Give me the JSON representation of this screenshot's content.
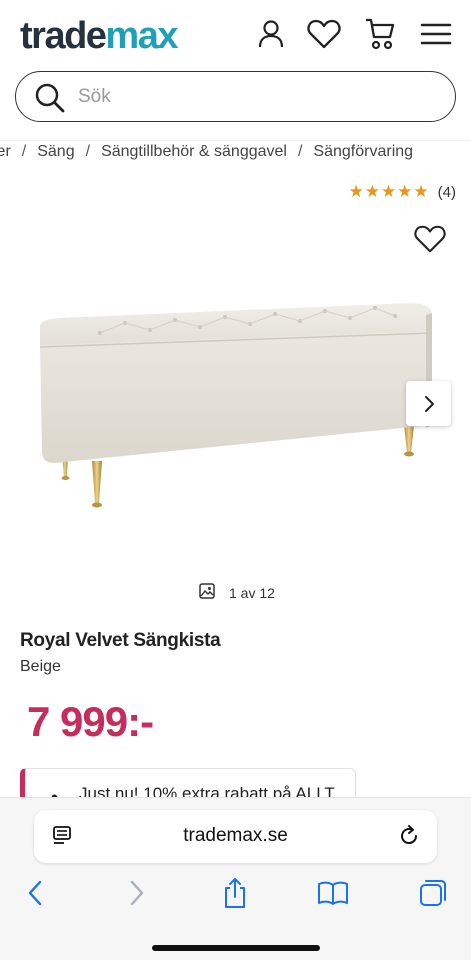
{
  "header": {
    "logo_part1": "trade",
    "logo_part2": "max",
    "icons": [
      "account-icon",
      "heart-icon",
      "cart-icon",
      "menu-icon"
    ]
  },
  "search": {
    "placeholder": "Sök"
  },
  "breadcrumb": [
    "ler",
    "Säng",
    "Sängtillbehör & sänggavel",
    "Sängförvaring"
  ],
  "rating": {
    "stars": "★★★★★",
    "value": 5,
    "count": "(4)"
  },
  "gallery": {
    "counter": "1 av 12",
    "current": 1,
    "total": 12
  },
  "product": {
    "title": "Royal Velvet Sängkista",
    "color": "Beige",
    "price": "7 999:-"
  },
  "promo": {
    "text": "Just nu! 10% extra rabatt på ALLT"
  },
  "browser": {
    "url": "trademax.se"
  },
  "colors": {
    "brand_dark": "#25313d",
    "brand_teal": "#1f9fb8",
    "price": "#c52d5d",
    "stars": "#e59819",
    "ios_blue": "#1a73e8"
  }
}
